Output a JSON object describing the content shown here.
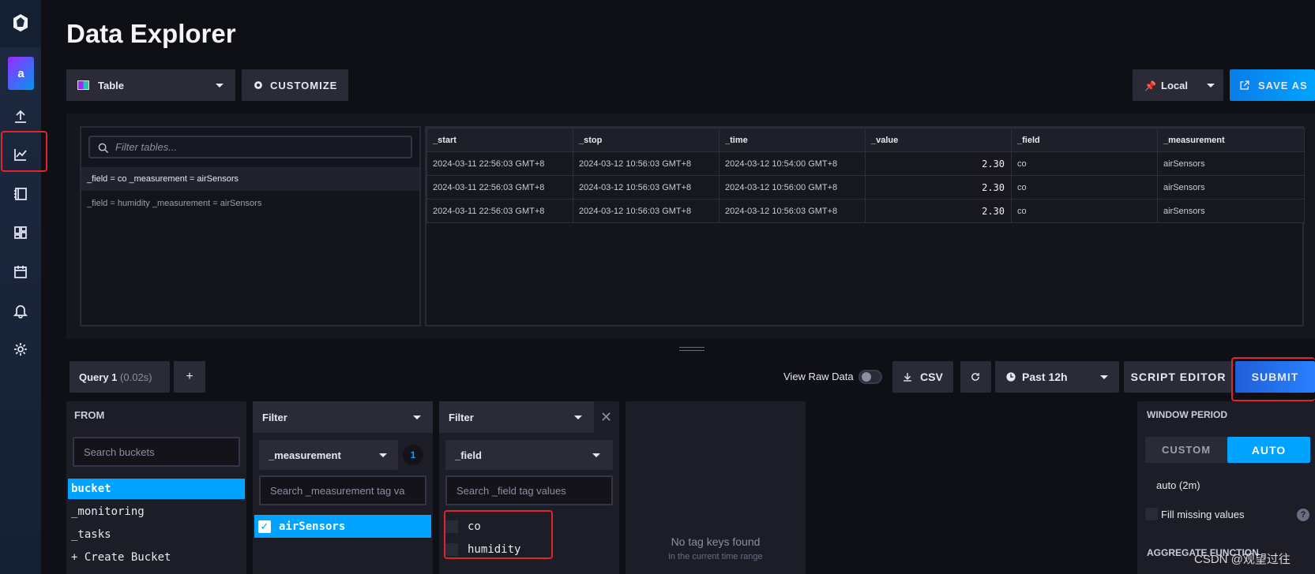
{
  "page_title": "Data Explorer",
  "sidebar": {
    "avatar_letter": "a",
    "items": [
      "load-data-icon",
      "data-explorer-icon",
      "notebooks-icon",
      "dashboards-icon",
      "tasks-icon",
      "alerts-icon",
      "settings-icon"
    ]
  },
  "toolbar": {
    "view_type": "Table",
    "customize_label": "CUSTOMIZE",
    "timezone": "Local",
    "save_as_label": "SAVE AS"
  },
  "tables_panel": {
    "filter_placeholder": "Filter tables...",
    "tables": [
      "_field = co _measurement = airSensors",
      "_field = humidity _measurement = airSensors"
    ]
  },
  "result_table": {
    "columns": [
      "_start",
      "_stop",
      "_time",
      "_value",
      "_field",
      "_measurement"
    ],
    "rows": [
      [
        "2024-03-11 22:56:03 GMT+8",
        "2024-03-12 10:56:03 GMT+8",
        "2024-03-12 10:54:00 GMT+8",
        "2.30",
        "co",
        "airSensors"
      ],
      [
        "2024-03-11 22:56:03 GMT+8",
        "2024-03-12 10:56:03 GMT+8",
        "2024-03-12 10:56:00 GMT+8",
        "2.30",
        "co",
        "airSensors"
      ],
      [
        "2024-03-11 22:56:03 GMT+8",
        "2024-03-12 10:56:03 GMT+8",
        "2024-03-12 10:56:03 GMT+8",
        "2.30",
        "co",
        "airSensors"
      ]
    ]
  },
  "query_bar": {
    "query_tab": "Query 1",
    "query_time": "(0.02s)",
    "add_label": "+",
    "view_raw_label": "View Raw Data",
    "csv_label": "CSV",
    "time_range": "Past 12h",
    "script_editor_label": "SCRIPT EDITOR",
    "submit_label": "SUBMIT"
  },
  "from_card": {
    "title": "FROM",
    "search_placeholder": "Search buckets",
    "buckets": [
      "bucket",
      "_monitoring",
      "_tasks",
      "+ Create Bucket"
    ]
  },
  "filter1": {
    "title": "Filter",
    "key": "_measurement",
    "count": "1",
    "search_placeholder": "Search _measurement tag va",
    "values": [
      "airSensors"
    ]
  },
  "filter2": {
    "title": "Filter",
    "key": "_field",
    "search_placeholder": "Search _field tag values",
    "values": [
      "co",
      "humidity"
    ]
  },
  "empty_card": {
    "title": "No tag keys found",
    "subtitle": "in the current time range"
  },
  "window_period": {
    "title": "WINDOW PERIOD",
    "custom_label": "CUSTOM",
    "auto_label": "AUTO",
    "auto_value": "auto (2m)",
    "fill_missing_label": "Fill missing values",
    "help_label": "?",
    "aggregate_title": "AGGREGATE FUNCTION"
  },
  "watermark": "CSDN @观望过往",
  "colors": {
    "accent": "#00a3ff",
    "submit": "#1f6fe0",
    "highlight": "#e0252c"
  }
}
